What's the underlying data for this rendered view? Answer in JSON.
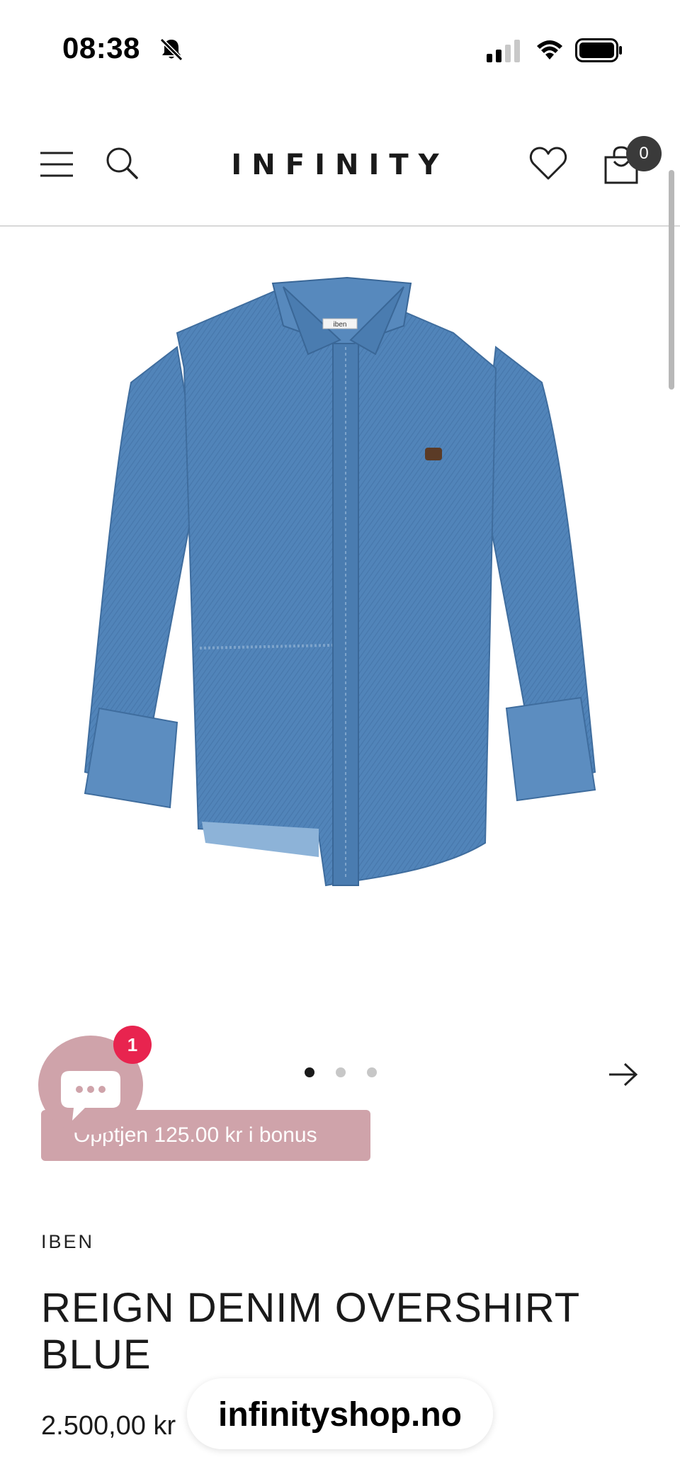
{
  "status_bar": {
    "time": "08:38"
  },
  "header": {
    "logo_text": "INFINITY",
    "cart_count": "0"
  },
  "carousel": {
    "active_index": 0,
    "total_slides": 3
  },
  "chat": {
    "unread_badge": "1"
  },
  "bonus": {
    "label": "Opptjen 125.00 kr i bonus"
  },
  "product": {
    "brand": "IBEN",
    "title": "REIGN DENIM OVERSHIRT BLUE",
    "price": "2.500,00 kr",
    "label_tag": "iben"
  },
  "browser": {
    "domain": "infinityshop.no"
  },
  "colors": {
    "accent_pink": "#cfa3aa",
    "badge_red": "#e8244f",
    "denim": "#4f7fb5"
  },
  "icons": [
    "bell-slash-icon",
    "signal-icon",
    "wifi-icon",
    "battery-icon",
    "menu-icon",
    "search-icon",
    "heart-icon",
    "bag-icon",
    "chat-icon",
    "arrow-right-icon"
  ]
}
